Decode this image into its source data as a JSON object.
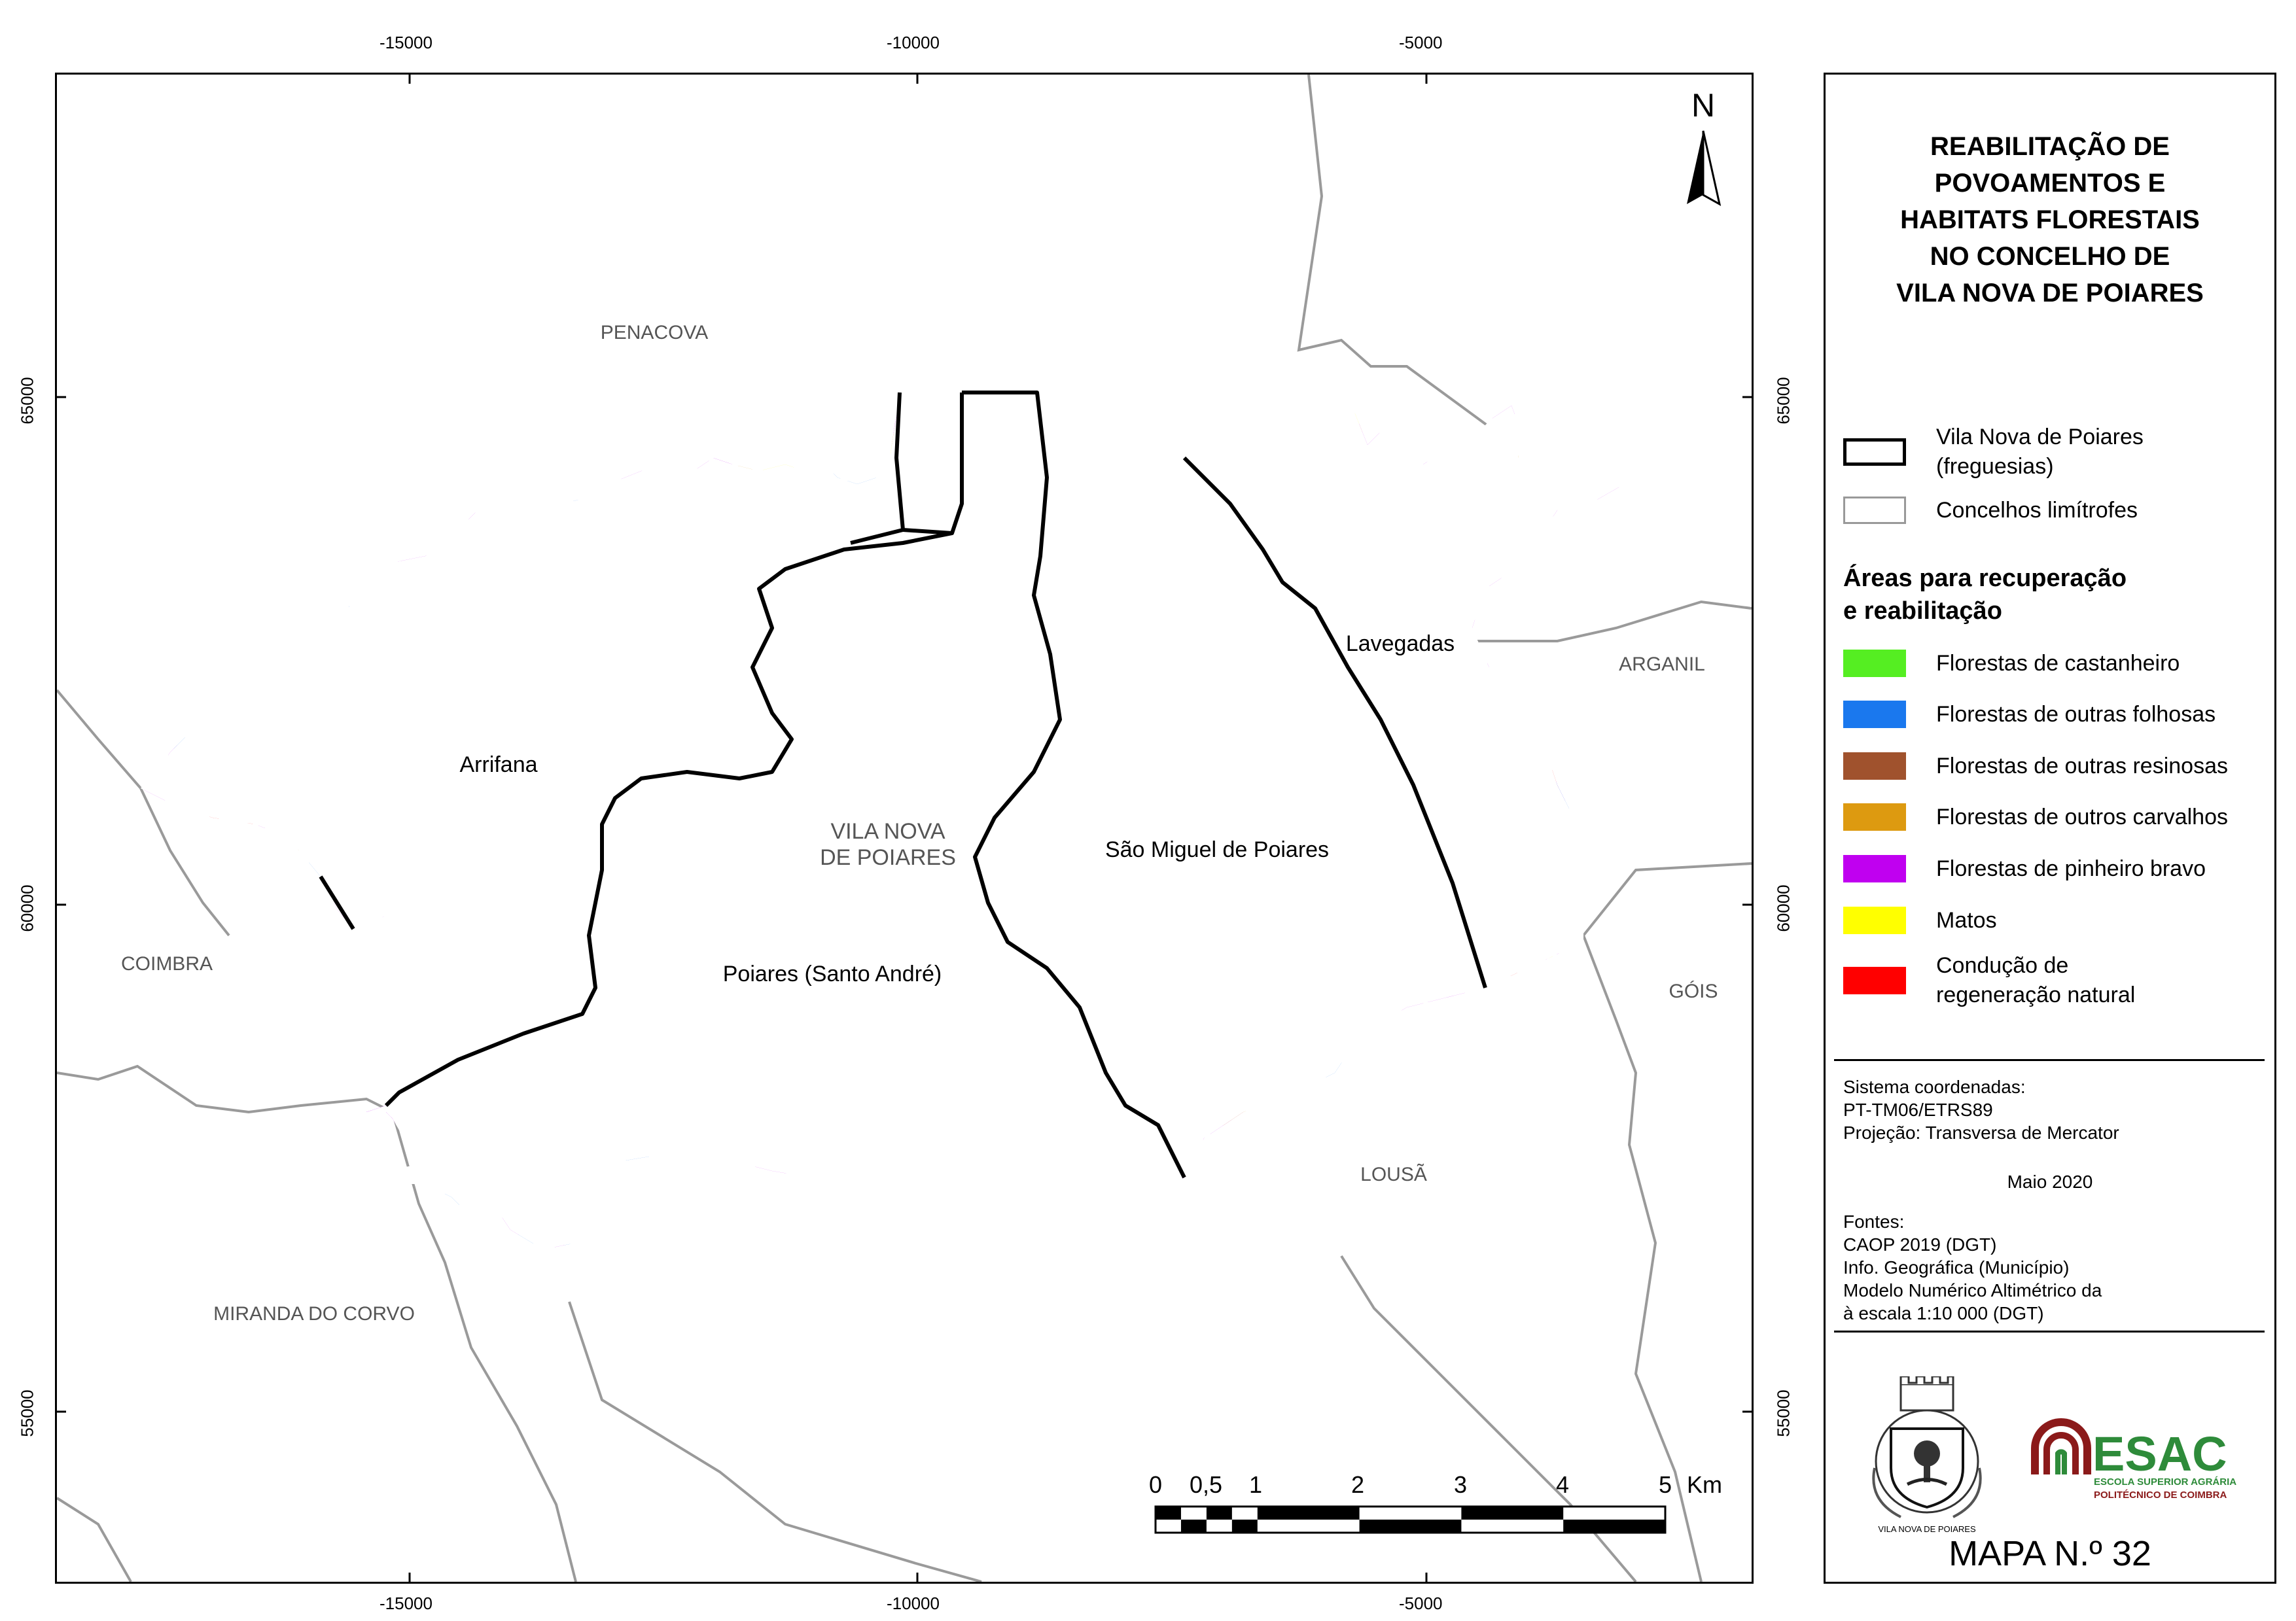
{
  "map": {
    "places_neighbors": {
      "penacova": "PENACOVA",
      "arganil": "ARGANIL",
      "coimbra": "COIMBRA",
      "gois": "GÓIS",
      "lousa": "LOUSÃ",
      "miranda": "MIRANDA DO CORVO",
      "vila_nova_1": "VILA NOVA",
      "vila_nova_2": "DE POIARES"
    },
    "places_parishes": {
      "arrifana": "Arrifana",
      "lavegadas": "Lavegadas",
      "sao_miguel": "São Miguel de Poiares",
      "santo_andre": "Poiares (Santo André)"
    },
    "north_label": "N",
    "grid_x": [
      "-15000",
      "-10000",
      "-5000"
    ],
    "grid_y": [
      "65000",
      "60000",
      "55000"
    ],
    "scale": {
      "labels": [
        "0",
        "0,5",
        "1",
        "2",
        "3",
        "4",
        "5"
      ],
      "unit": "Km"
    },
    "colors": {
      "castanheiro": "#55ee22",
      "folhosas": "#1a78ee",
      "resinosas": "#a0522d",
      "carvalhos": "#dd9a10",
      "pinheiro": "#c000f0",
      "matos": "#ffff00",
      "regeneracao": "#ff0000"
    }
  },
  "legend": {
    "title": [
      "REABILITAÇÃO DE",
      "POVOAMENTOS E",
      "HABITATS FLORESTAIS",
      "NO CONCELHO DE",
      "VILA NOVA DE POIARES"
    ],
    "boundary_1_line1": "Vila Nova de Poiares",
    "boundary_1_line2": "(freguesias)",
    "boundary_2": "Concelhos limítrofes",
    "section_head_1": "Áreas para recuperação",
    "section_head_2": "e reabilitação",
    "classes": [
      {
        "label": "Florestas de castanheiro",
        "color": "#55ee22"
      },
      {
        "label": "Florestas de outras folhosas",
        "color": "#1a78ee"
      },
      {
        "label": "Florestas de outras resinosas",
        "color": "#a0522d"
      },
      {
        "label": "Florestas de outros carvalhos",
        "color": "#dd9a10"
      },
      {
        "label": "Florestas de pinheiro bravo",
        "color": "#c000f0"
      },
      {
        "label": "Matos",
        "color": "#ffff00"
      },
      {
        "label": "Condução de",
        "label2": "regeneração natural",
        "color": "#ff0000"
      }
    ],
    "info": {
      "sys1": "Sistema coordenadas:",
      "sys2": "PT-TM06/ETRS89",
      "proj": "Projeção: Transversa de Mercator",
      "date": "Maio 2020",
      "src0": "Fontes:",
      "src1": "CAOP 2019 (DGT)",
      "src2": "Info. Geográfica (Município)",
      "src3": "Modelo Numérico Altimétrico da",
      "src4": "à escala 1:10 000 (DGT)"
    },
    "logo_municipio_text": "VILA NOVA DE POIARES",
    "logo_esac": "ESAC",
    "logo_esac_sub1": "ESCOLA SUPERIOR AGRÁRIA",
    "logo_esac_sub2": "POLITÉCNICO DE COIMBRA",
    "map_number": "MAPA N.º 32"
  }
}
